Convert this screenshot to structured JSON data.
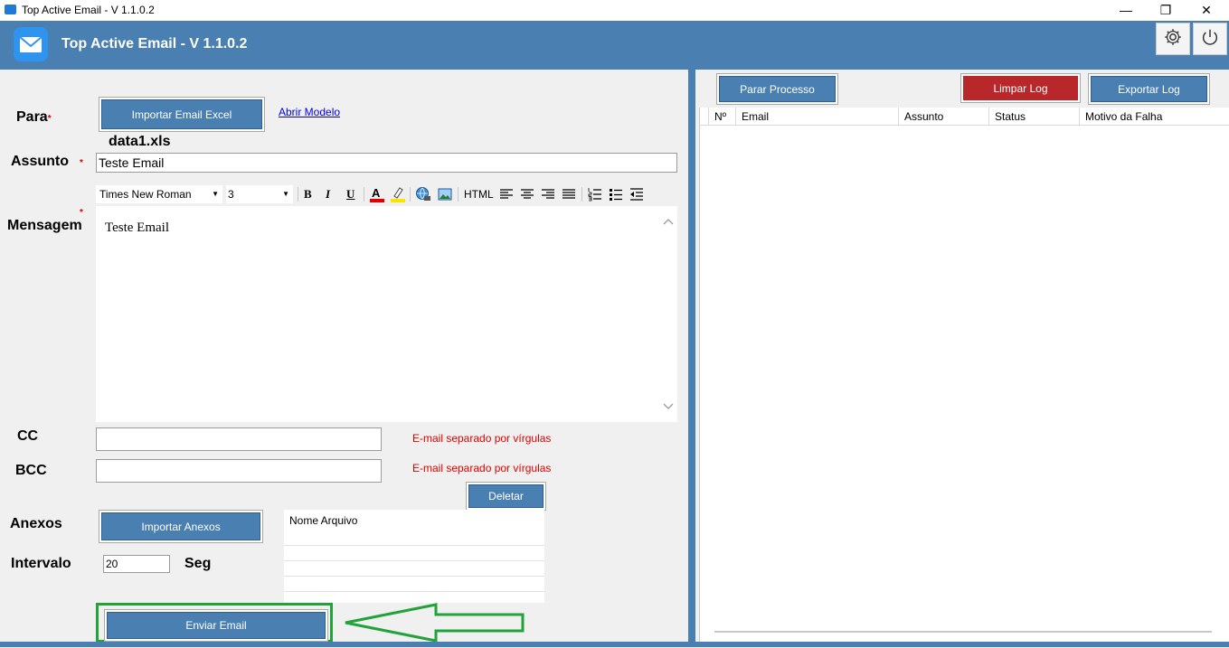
{
  "window": {
    "title": "Top Active Email - V 1.1.0.2",
    "minimize": "—",
    "maximize": "❐",
    "close": "✕"
  },
  "header": {
    "title": "Top Active Email - V 1.1.0.2"
  },
  "form": {
    "para_label": "Para",
    "import_excel_btn": "Importar Email Excel",
    "open_template_link": "Abrir Modelo",
    "imported_file": "data1.xls",
    "subject_label": "Assunto",
    "subject_value": "Teste Email",
    "message_label": "Mensagem",
    "required_mark": "*",
    "editor": {
      "font": "Times New Roman",
      "size": "3",
      "bold": "B",
      "italic": "I",
      "underline": "U",
      "html": "HTML",
      "body": "Teste Email"
    },
    "cc_label": "CC",
    "bcc_label": "BCC",
    "cc_hint": "E-mail separado por vírgulas",
    "bcc_hint": "E-mail separado por vírgulas",
    "delete_btn": "Deletar",
    "attachments_label": "Anexos",
    "import_attachments_btn": "Importar Anexos",
    "attachments_col": "Nome Arquivo",
    "interval_label": "Intervalo",
    "interval_value": "20",
    "interval_unit": "Seg",
    "send_btn": "Enviar Email"
  },
  "log": {
    "stop_btn": "Parar Processo",
    "clear_btn": "Limpar Log",
    "export_btn": "Exportar Log",
    "columns": [
      "Nº",
      "Email",
      "Assunto",
      "Status",
      "Motivo da Falha"
    ]
  },
  "colors": {
    "accent": "#4a7fb2",
    "danger": "#b8282a",
    "highlight": "#21a33a"
  }
}
